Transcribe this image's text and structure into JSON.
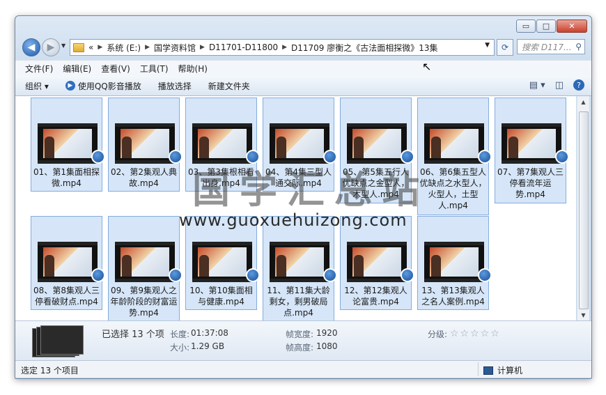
{
  "window": {
    "minimize": "▭",
    "maximize": "□",
    "close": "✕"
  },
  "address": {
    "overflow": "«",
    "crumbs": [
      "系统 (E:)",
      "国学资料馆",
      "D11701-D11800",
      "D11709 廖衡之《古法面相探微》13集"
    ],
    "search_placeholder": "搜索 D117..."
  },
  "menu": [
    "文件(F)",
    "编辑(E)",
    "查看(V)",
    "工具(T)",
    "帮助(H)"
  ],
  "toolbar": {
    "organize": "组织 ▾",
    "play_qq": "使用QQ影音播放",
    "play_select": "播放选择",
    "new_folder": "新建文件夹"
  },
  "files": [
    {
      "name": "01、第1集面相探微.mp4"
    },
    {
      "name": "02、第2集观人典故.mp4"
    },
    {
      "name": "03、第3集根相看出身.mp4"
    },
    {
      "name": "04、第4集三型人通交际.mp4"
    },
    {
      "name": "05、第5集五行人优缺点之金型人，木型人.mp4"
    },
    {
      "name": "06、第6集五型人优缺点之水型人，火型人，土型人.mp4"
    },
    {
      "name": "07、第7集观人三停看流年运势.mp4"
    },
    {
      "name": "08、第8集观人三停看破财点.mp4"
    },
    {
      "name": "09、第9集观人之年龄阶段的财富运势.mp4"
    },
    {
      "name": "10、第10集面相与健康.mp4"
    },
    {
      "name": "11、第11集大龄剩女，剩男破局点.mp4"
    },
    {
      "name": "12、第12集观人论富贵.mp4"
    },
    {
      "name": "13、第13集观人之名人案例.mp4"
    }
  ],
  "watermark": {
    "chinese": "国学汇总站",
    "url": "www.guoxuehuizong.com"
  },
  "details": {
    "selected": "已选择 13 个项",
    "length_label": "长度:",
    "length_value": "01:37:08",
    "size_label": "大小:",
    "size_value": "1.29 GB",
    "width_label": "帧宽度:",
    "width_value": "1920",
    "height_label": "帧高度:",
    "height_value": "1080",
    "rating_label": "分级:",
    "rating_stars": "☆☆☆☆☆"
  },
  "status": {
    "left": "选定 13 个项目",
    "right": "计算机"
  }
}
